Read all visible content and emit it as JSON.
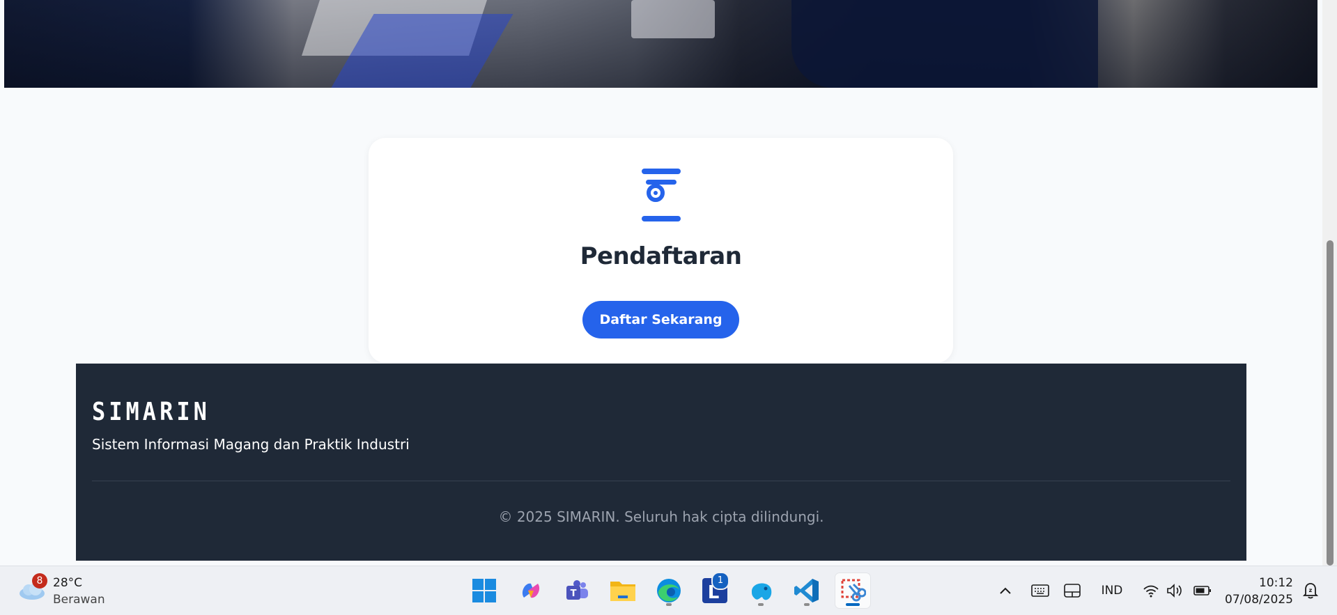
{
  "card": {
    "icon": "registration-icon",
    "title": "Pendaftaran",
    "button_label": "Daftar Sekarang"
  },
  "footer": {
    "brand": "SIMARIN",
    "tagline": "Sistem Informasi Magang dan Praktik Industri",
    "copyright": "© 2025 SIMARIN. Seluruh hak cipta dilindungi."
  },
  "taskbar": {
    "weather": {
      "badge": "8",
      "temperature": "28°C",
      "condition": "Berawan"
    },
    "apps": [
      {
        "name": "start-button",
        "icon": "windows-icon"
      },
      {
        "name": "copilot-app",
        "icon": "copilot-icon"
      },
      {
        "name": "teams-app",
        "icon": "teams-icon"
      },
      {
        "name": "file-explorer-app",
        "icon": "folder-icon"
      },
      {
        "name": "edge-app",
        "icon": "edge-icon"
      },
      {
        "name": "l-app",
        "icon": "l-app-icon",
        "badge": "1"
      },
      {
        "name": "blue-app",
        "icon": "blue-app-icon"
      },
      {
        "name": "vscode-app",
        "icon": "vscode-icon"
      },
      {
        "name": "snipping-tool-app",
        "icon": "snipping-tool-icon"
      }
    ],
    "tray": {
      "language": "IND",
      "time": "10:12",
      "date": "07/08/2025"
    }
  },
  "colors": {
    "accent": "#2563eb",
    "footer_bg": "#1f2937",
    "page_bg": "#f8fafc"
  }
}
